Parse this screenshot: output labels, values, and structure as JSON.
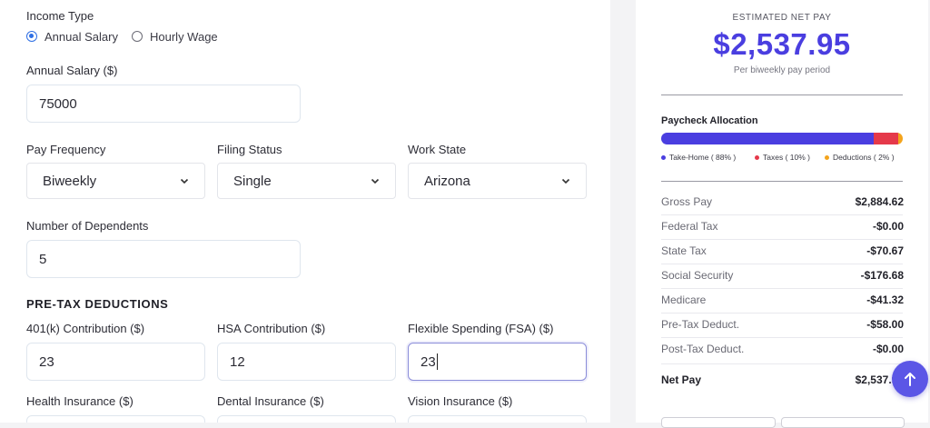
{
  "form": {
    "income_type": {
      "label": "Income Type",
      "options": [
        {
          "label": "Annual Salary",
          "selected": true
        },
        {
          "label": "Hourly Wage",
          "selected": false
        }
      ]
    },
    "annual_salary": {
      "label": "Annual Salary ($)",
      "value": "75000"
    },
    "pay_frequency": {
      "label": "Pay Frequency",
      "value": "Biweekly"
    },
    "filing_status": {
      "label": "Filing Status",
      "value": "Single"
    },
    "work_state": {
      "label": "Work State",
      "value": "Arizona"
    },
    "dependents": {
      "label": "Number of Dependents",
      "value": "5"
    },
    "pretax": {
      "title": "PRE-TAX DEDUCTIONS",
      "k401": {
        "label": "401(k) Contribution ($)",
        "value": "23"
      },
      "hsa": {
        "label": "HSA Contribution ($)",
        "value": "12"
      },
      "fsa": {
        "label": "Flexible Spending (FSA) ($)",
        "value": "23"
      }
    },
    "insurance": {
      "health_label": "Health Insurance ($)",
      "dental_label": "Dental Insurance ($)",
      "vision_label": "Vision Insurance ($)"
    }
  },
  "results": {
    "eyebrow": "ESTIMATED NET PAY",
    "net_pay": "$2,537.95",
    "period_note": "Per biweekly pay period",
    "allocation": {
      "title": "Paycheck Allocation",
      "segments": [
        {
          "label": "Take-Home ( 88% )",
          "percent": 88,
          "color": "#4a3ee0"
        },
        {
          "label": "Taxes ( 10% )",
          "percent": 10,
          "color": "#e5394a"
        },
        {
          "label": "Deductions ( 2% )",
          "percent": 2,
          "color": "#f4a41c"
        }
      ]
    },
    "rows": [
      {
        "label": "Gross Pay",
        "value": "$2,884.62"
      },
      {
        "label": "Federal Tax",
        "value": "-$0.00"
      },
      {
        "label": "State Tax",
        "value": "-$70.67"
      },
      {
        "label": "Social Security",
        "value": "-$176.68"
      },
      {
        "label": "Medicare",
        "value": "-$41.32"
      },
      {
        "label": "Pre-Tax Deduct.",
        "value": "-$58.00"
      },
      {
        "label": "Post-Tax Deduct.",
        "value": "-$0.00"
      }
    ],
    "net_row": {
      "label": "Net Pay",
      "value": "$2,537.95"
    }
  },
  "icons": {
    "scroll_top": "arrow-up-icon",
    "select_chevron": "chevron-down-icon"
  }
}
